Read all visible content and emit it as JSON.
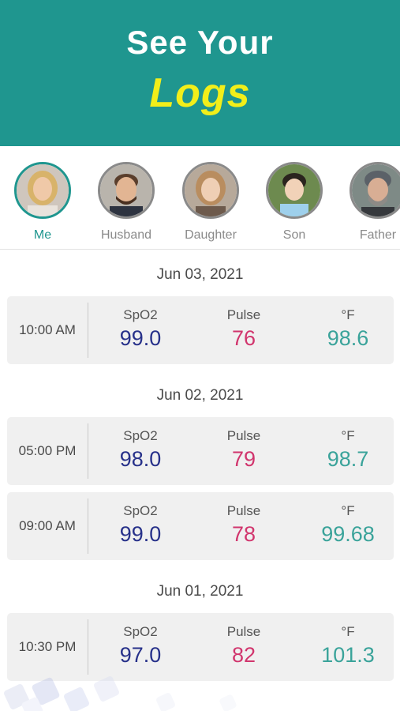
{
  "header": {
    "line1": "See Your",
    "line2": "Logs"
  },
  "colors": {
    "header_bg": "#1f968f",
    "highlight_yellow": "#f2ee1a",
    "spo2": "#27318a",
    "pulse": "#d1356d",
    "temperature": "#3aa39a"
  },
  "profiles": [
    {
      "name": "Me",
      "active": true,
      "icon": "avatar-photo"
    },
    {
      "name": "Husband",
      "active": false,
      "icon": "avatar-photo"
    },
    {
      "name": "Daughter",
      "active": false,
      "icon": "avatar-photo"
    },
    {
      "name": "Son",
      "active": false,
      "icon": "avatar-photo"
    },
    {
      "name": "Father",
      "active": false,
      "icon": "avatar-photo"
    }
  ],
  "metric_labels": {
    "spo2": "SpO2",
    "pulse": "Pulse",
    "temp": "°F"
  },
  "log_groups": [
    {
      "date": "Jun 03, 2021",
      "entries": [
        {
          "time": "10:00 AM",
          "spo2": "99.0",
          "pulse": "76",
          "temp": "98.6"
        }
      ]
    },
    {
      "date": "Jun 02, 2021",
      "entries": [
        {
          "time": "05:00 PM",
          "spo2": "98.0",
          "pulse": "79",
          "temp": "98.7"
        },
        {
          "time": "09:00 AM",
          "spo2": "99.0",
          "pulse": "78",
          "temp": "99.68"
        }
      ]
    },
    {
      "date": "Jun 01, 2021",
      "entries": [
        {
          "time": "10:30 PM",
          "spo2": "97.0",
          "pulse": "82",
          "temp": "101.3"
        }
      ]
    }
  ]
}
